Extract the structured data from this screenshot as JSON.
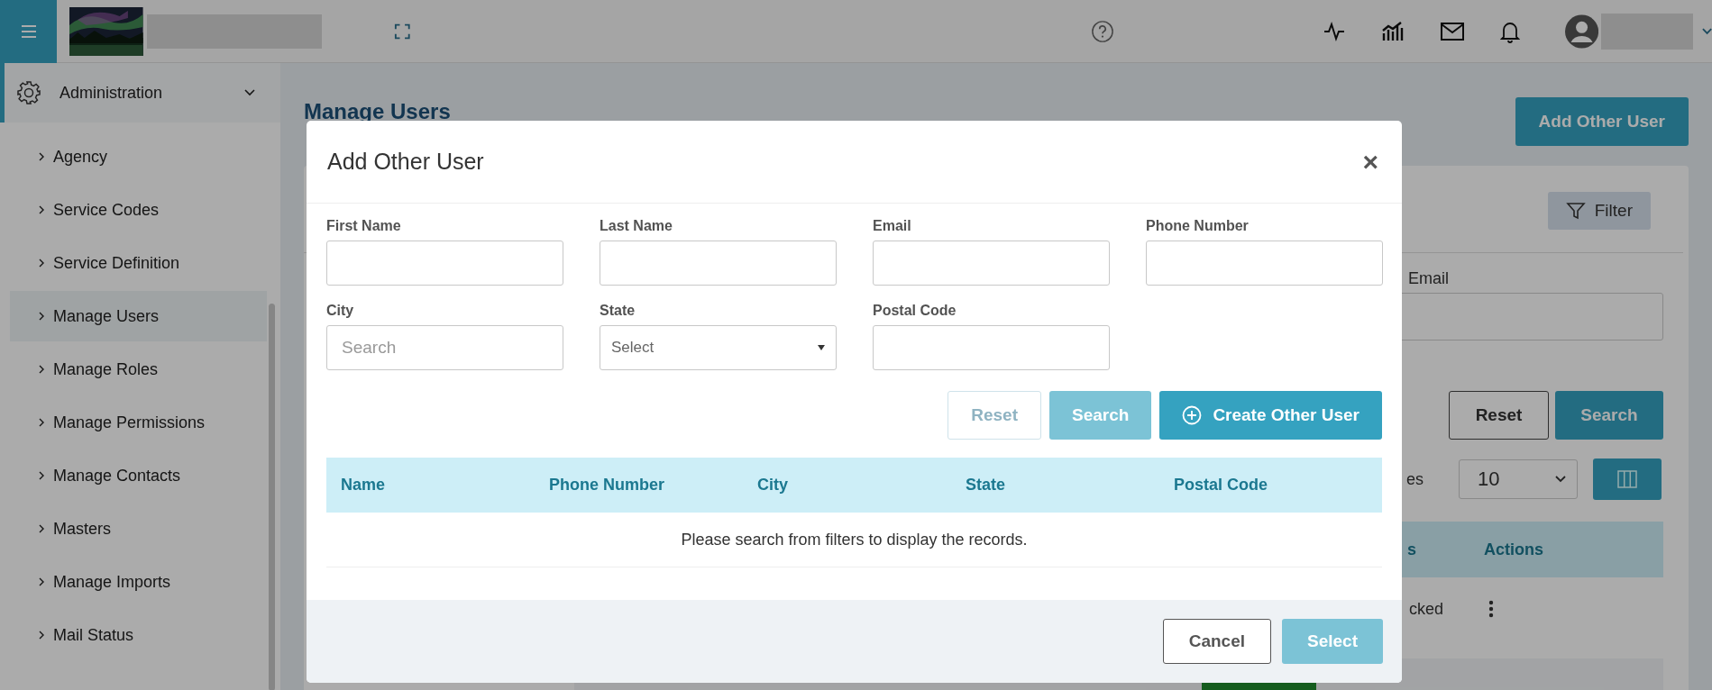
{
  "sidebar": {
    "section": {
      "label": "Administration",
      "expanded": true
    },
    "items": [
      {
        "label": "Agency",
        "selected": false
      },
      {
        "label": "Service Codes",
        "selected": false
      },
      {
        "label": "Service Definition",
        "selected": false
      },
      {
        "label": "Manage Users",
        "selected": true
      },
      {
        "label": "Manage Roles",
        "selected": false
      },
      {
        "label": "Manage Permissions",
        "selected": false
      },
      {
        "label": "Manage Contacts",
        "selected": false
      },
      {
        "label": "Masters",
        "selected": false
      },
      {
        "label": "Manage Imports",
        "selected": false
      },
      {
        "label": "Mail Status",
        "selected": false
      }
    ]
  },
  "page": {
    "title": "Manage Users",
    "add_button": "Add Other User",
    "filter_button": "Filter",
    "email_label": "Email",
    "reset_button": "Reset",
    "search_button": "Search",
    "page_size_label": "es",
    "page_size": "10",
    "table_columns": [
      "s",
      "Actions"
    ],
    "rows": [
      {
        "status": "cked"
      }
    ]
  },
  "dialog": {
    "title": "Add Other User",
    "close": "×",
    "fields": [
      {
        "label": "First Name",
        "kind": "text"
      },
      {
        "label": "Last Name",
        "kind": "text"
      },
      {
        "label": "Email",
        "kind": "text"
      },
      {
        "label": "Phone Number",
        "kind": "text"
      },
      {
        "label": "City",
        "kind": "text",
        "placeholder": "Search"
      },
      {
        "label": "State",
        "kind": "select",
        "placeholder": "Select"
      },
      {
        "label": "Postal Code",
        "kind": "text"
      }
    ],
    "buttons": [
      {
        "label": "Reset",
        "kind": "outline",
        "disabled": true
      },
      {
        "label": "Search",
        "kind": "primary",
        "disabled": true
      },
      {
        "label": "Create Other User",
        "kind": "create",
        "disabled": false
      }
    ],
    "table": {
      "columns": [
        "Name",
        "Phone Number",
        "City",
        "State",
        "Postal Code"
      ],
      "empty_message": "Please search from filters to display the records."
    },
    "footer_buttons": [
      {
        "label": "Cancel",
        "kind": "outline",
        "disabled": false
      },
      {
        "label": "Select",
        "kind": "primary",
        "disabled": true
      }
    ]
  }
}
